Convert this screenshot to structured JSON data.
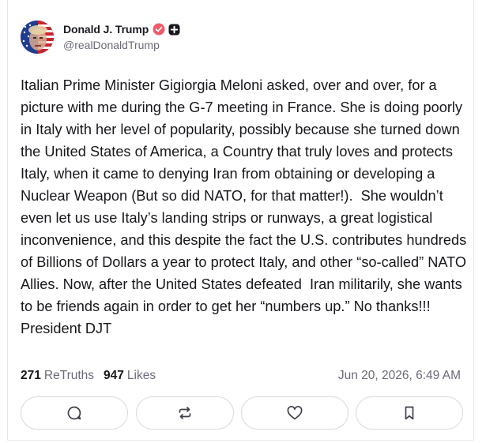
{
  "post": {
    "author": {
      "display_name": "Donald J. Trump",
      "handle": "@realDonaldTrump",
      "avatar_icon": "flag-portrait-avatar",
      "verified_icon": "verified-badge-icon",
      "verified_color": "#f05a6a",
      "plus_icon": "plus-badge-icon"
    },
    "text": "Italian Prime Minister Gigiorgia Meloni asked, over and over, for a picture with me during the G-7 meeting in France. She is doing poorly in Italy with her level of popularity, possibly because she turned down the United States of America, a Country that truly loves and protects Italy, when it came to denying Iran from obtaining or developing a Nuclear Weapon (But so did NATO, for that matter!).  She wouldn’t even let us use Italy’s landing strips or runways, a great logistical inconvenience, and this despite the fact the U.S. contributes hundreds of Billions of Dollars a year to protect Italy, and other “so-called” NATO Allies. Now, after the United States defeated  Iran militarily, she wants to be friends again in order to get her “numbers up.” No thanks!!! President DJT",
    "stats": {
      "retruths_count": "271",
      "retruths_label": "ReTruths",
      "likes_count": "947",
      "likes_label": "Likes"
    },
    "timestamp": "Jun 20, 2026, 6:49 AM",
    "actions": [
      {
        "name": "reply",
        "icon": "comment-icon"
      },
      {
        "name": "retruth",
        "icon": "repost-icon"
      },
      {
        "name": "like",
        "icon": "heart-icon"
      },
      {
        "name": "bookmark",
        "icon": "bookmark-icon"
      }
    ]
  }
}
